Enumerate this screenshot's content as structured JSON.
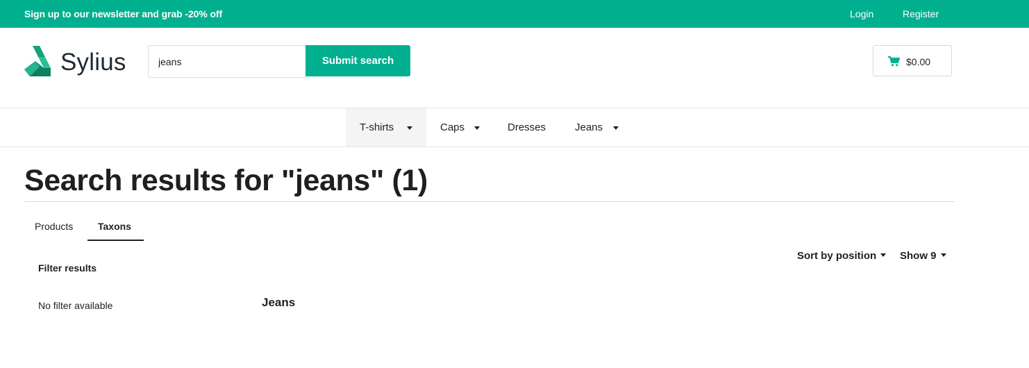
{
  "topbar": {
    "promo_text": "Sign up to our newsletter and grab -20% off",
    "login_label": "Login",
    "register_label": "Register",
    "background_color": "#00b08f"
  },
  "header": {
    "logo_text": "Sylius",
    "search": {
      "value": "jeans",
      "button_label": "Submit search"
    },
    "cart": {
      "icon": "cart-icon",
      "total": "$0.00"
    }
  },
  "nav": {
    "items": [
      {
        "label": "T-shirts",
        "has_dropdown": true,
        "active": true
      },
      {
        "label": "Caps",
        "has_dropdown": true
      },
      {
        "label": "Dresses",
        "has_dropdown": false
      },
      {
        "label": "Jeans",
        "has_dropdown": true
      }
    ]
  },
  "main": {
    "title": "Search results for \"jeans\" (1)",
    "tabs": [
      {
        "label": "Products",
        "active": false
      },
      {
        "label": "Taxons",
        "active": true
      }
    ],
    "sort_label": "Sort by position",
    "show_label": "Show 9",
    "filter": {
      "heading": "Filter results",
      "empty_text": "No filter available"
    },
    "results": [
      {
        "name": "Jeans"
      }
    ]
  },
  "colors": {
    "accent": "#00b08f",
    "text": "#1f1f1f"
  }
}
